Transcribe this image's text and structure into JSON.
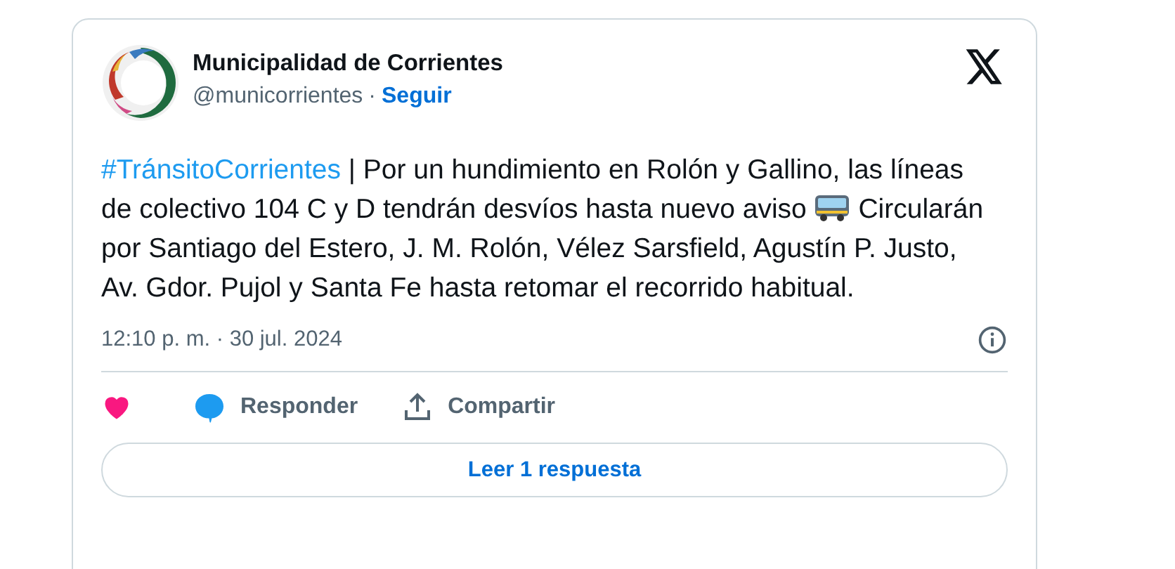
{
  "author": {
    "name": "Municipalidad de Corrientes",
    "handle": "@municorrientes",
    "separator": "·",
    "follow": "Seguir"
  },
  "tweet": {
    "hashtag": "#TránsitoCorrientes",
    "text_before": " | Por un hundimiento en Rolón y Gallino, las líneas de colectivo 104 C y D tendrán desvíos hasta nuevo aviso ",
    "text_after": " Circularán por Santiago del Estero, J. M. Rolón, Vélez Sarsfield, Agustín P. Justo, Av. Gdor. Pujol y Santa Fe hasta retomar el recorrido habitual."
  },
  "timestamp": "12:10 p. m. · 30 jul. 2024",
  "actions": [
    {
      "kind": "like"
    },
    {
      "kind": "reply",
      "label": "Responder"
    },
    {
      "kind": "share",
      "label": "Compartir"
    }
  ],
  "read_replies": "Leer 1 respuesta"
}
